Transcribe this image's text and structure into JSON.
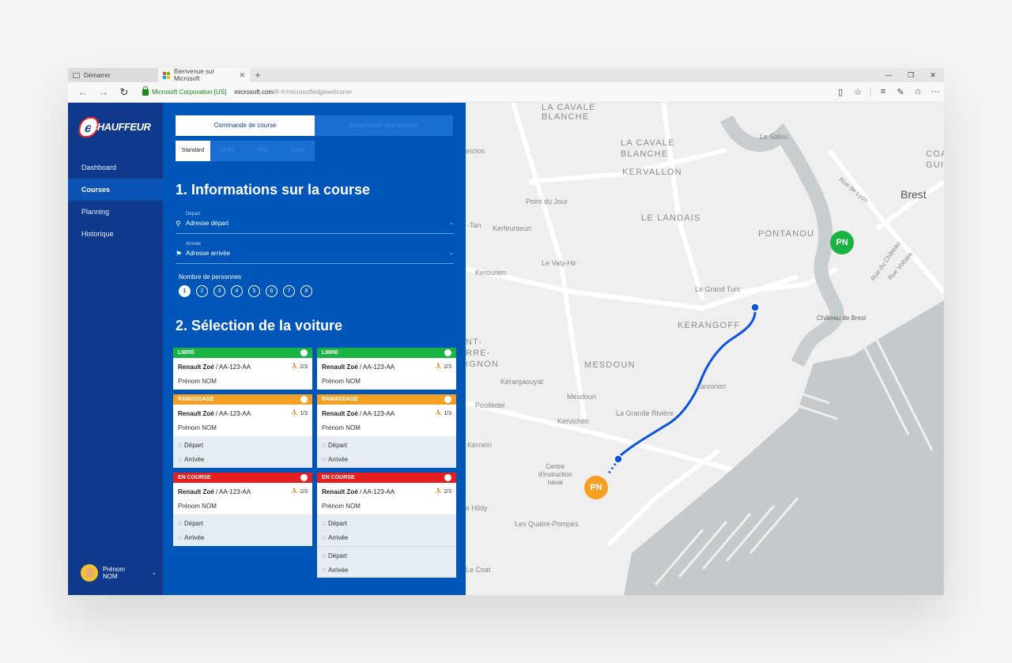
{
  "browser": {
    "tabs": [
      {
        "label": "Démarrer"
      },
      {
        "label": "Bienvenue sur Microsoft"
      }
    ],
    "new_tab": "+",
    "close_tab": "✕",
    "cert": "Microsoft Corporation [US]",
    "url_host": "microsoft.com",
    "url_path": "/fr-fr/microsoftedgewelcome"
  },
  "sidebar": {
    "logo": "CHAUFFEUR",
    "items": [
      {
        "label": "Dashboard"
      },
      {
        "label": "Courses"
      },
      {
        "label": "Planning"
      },
      {
        "label": "Historique"
      }
    ],
    "user": {
      "first": "Prénom",
      "last": "NOM"
    }
  },
  "panel": {
    "tabs": [
      "Commande de course",
      "Supervision des courses"
    ],
    "subtabs": [
      "Standard",
      "OPEX",
      "Fret",
      "Santé"
    ],
    "section1": "1. Informations sur la course",
    "depart": {
      "label": "Départ",
      "value": "Adresse départ"
    },
    "arrivee": {
      "label": "Arrivée",
      "value": "Adresse arrivée"
    },
    "nb_label": "Nombre de personnes",
    "nb_options": [
      "1",
      "2",
      "3",
      "4",
      "5",
      "6",
      "7",
      "8"
    ],
    "section2": "2. Sélection de la voiture"
  },
  "cards": {
    "left": [
      {
        "status": "LIBRE",
        "car": "Renault Zoé",
        "plate": " / AA-123-AA",
        "cap": "2/3",
        "driver": "Prénom NOM"
      },
      {
        "status": "RAMASSAGE",
        "car": "Renault Zoé",
        "plate": " / AA-123-AA",
        "cap": "1/3",
        "driver": "Prénom NOM",
        "depart": "Départ",
        "arrivee": "Arrivée"
      },
      {
        "status": "EN COURSE",
        "car": "Renault Zoé",
        "plate": " / AA-123-AA",
        "cap": "2/3",
        "driver": "Prénom NOM",
        "depart": "Départ",
        "arrivee": "Arrivée"
      }
    ],
    "right": [
      {
        "status": "LIBRE",
        "car": "Renault Zoé",
        "plate": " / AA-123-AA",
        "cap": "2/3",
        "driver": "Prénom NOM"
      },
      {
        "status": "RAMASSAGE",
        "car": "Renault Zoé",
        "plate": " / AA-123-AA",
        "cap": "1/3",
        "driver": "Prénom NOM",
        "depart": "Départ",
        "arrivee": "Arrivée"
      },
      {
        "status": "EN COURSE",
        "car": "Renault Zoé",
        "plate": " / AA-123-AA",
        "cap": "2/3",
        "driver": "Prénom NOM",
        "depart": "Départ",
        "arrivee": "Arrivée",
        "depart2": "Départ",
        "arrivee2": "Arrivée"
      }
    ],
    "cap_icon": "⛹"
  },
  "map": {
    "labels": {
      "cavale1": "LA CAVALE\nBLANCHE",
      "cavale2": "LA CAVALE\nBLANCHE",
      "kervallon": "KERVALLON",
      "le_salou": "Le Salou",
      "coa": "COA\nGUI",
      "brest": "Brest",
      "rue_lyon": "Rue de Lyon",
      "point_jour": "Point du Jour",
      "le_landais": "LE LANDAIS",
      "kerfeunteun": "Kerfeunteun",
      "tan": "-Tan",
      "esnos": "esnos",
      "pontanou": "PONTANOU",
      "rue_chateau": "Rue du Château",
      "rue_voltaire": "Rue Voltaire",
      "valy_hir": "Le Valy-Hir",
      "kerourien": "Kerourien",
      "grand_turc": "Le Grand Turc",
      "chateau_brest": "Château de Brest",
      "kerangoff": "KERANGOFF",
      "saint_pierre": "NT-\nRRE-\nIGNON",
      "mesdoun_big": "MESDOUN",
      "kerargaouyat": "Kérargaouyat",
      "lanninon": "Lanninon",
      "mesdoun": "Mesdoun",
      "poulleder": "Poulléder",
      "grande_riviere": "La Grande Rivière",
      "kervichen": "Kervichen",
      "kernein": "Kernein",
      "centre": "Centre\nd'instruction\nnaval",
      "hildy": "e Hildy",
      "quatre_pompes": "Les Quatre-Pompes",
      "le_coat": "Le Coat"
    },
    "pin_green": "PN",
    "pin_orange": "PN"
  }
}
